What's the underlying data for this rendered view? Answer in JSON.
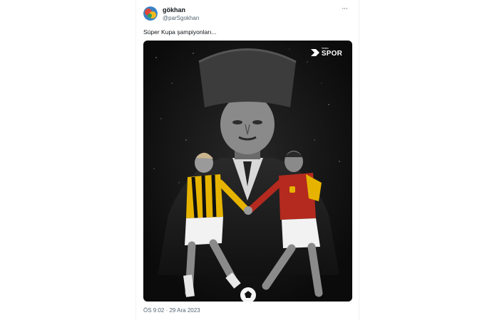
{
  "tweet": {
    "author_name": "gökhan",
    "author_handle": "@parSgokhan",
    "text": "Süper Kupa şampiyonları...",
    "timestamp": "ÖS 9:02 · 29 Ara 2023",
    "more_label": "···"
  },
  "media": {
    "logo_small": "Vertex",
    "logo_big": "SPOR"
  },
  "colors": {
    "text_primary": "#0f1419",
    "text_secondary": "#536471",
    "media_bg": "#0c0c0c",
    "jersey_yellow": "#e6b400",
    "jersey_red": "#b42a1f"
  },
  "icons": {
    "more": "more-options-icon",
    "avatar": "avatar",
    "logo": "tv-spor-logo-icon"
  }
}
